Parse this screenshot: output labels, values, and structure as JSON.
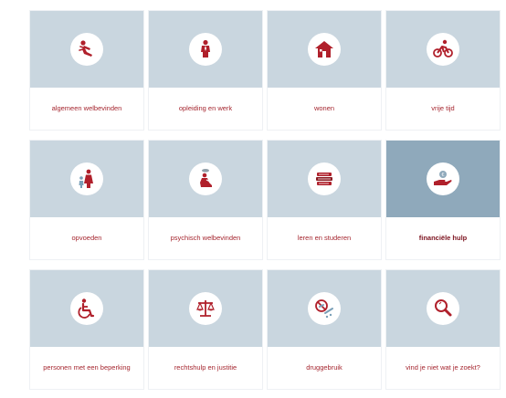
{
  "theme": {
    "accent": "#b0202b",
    "tile_bg": "#c9d6df",
    "tile_active_bg": "#8fa9bb",
    "label_color": "#a5262f"
  },
  "tiles": [
    {
      "label": "algemeen welbevinden",
      "icon": "fallen-person-icon",
      "active": false
    },
    {
      "label": "opleiding en werk",
      "icon": "person-with-tie-icon",
      "active": false
    },
    {
      "label": "wonen",
      "icon": "house-icon",
      "active": false
    },
    {
      "label": "vrije tijd",
      "icon": "cyclist-icon",
      "active": false
    },
    {
      "label": "opvoeden",
      "icon": "parent-child-icon",
      "active": false
    },
    {
      "label": "psychisch welbevinden",
      "icon": "sad-person-icon",
      "active": false
    },
    {
      "label": "leren en studeren",
      "icon": "books-icon",
      "active": false
    },
    {
      "label": "financiële hulp",
      "icon": "hand-with-coin-icon",
      "active": true
    },
    {
      "label": "personen met een beperking",
      "icon": "wheelchair-icon",
      "active": false
    },
    {
      "label": "rechtshulp en justitie",
      "icon": "scales-icon",
      "active": false
    },
    {
      "label": "druggebruik",
      "icon": "no-drugs-icon",
      "active": false
    },
    {
      "label": "vind je niet wat je zoekt?",
      "icon": "magnifier-icon",
      "active": false
    }
  ]
}
